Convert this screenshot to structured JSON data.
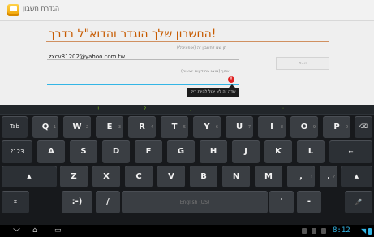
{
  "window": {
    "title": "הגדרת חשבון"
  },
  "form": {
    "heading": "החשבון שלך הוגדר והדוא\"ל בדרך!",
    "email_label": "תן שם לחשבון זה (אופציונלי)",
    "email_value": "zxcv81202@yahoo.com.tw",
    "name_label": "שמך (מוצג בהודעות יוצאות)",
    "next_label": "הבא",
    "error_tooltip": "שדה זה לא יכול להיות ריק",
    "error_mark": "!"
  },
  "keyboard": {
    "suggestions": [
      "!",
      "?",
      ",",
      ".",
      ":"
    ],
    "row1": [
      {
        "label": "Tab",
        "name": "key-tab"
      },
      {
        "label": "Q",
        "name": "key-q",
        "hint": "1"
      },
      {
        "label": "W",
        "name": "key-w",
        "hint": "2"
      },
      {
        "label": "E",
        "name": "key-e",
        "hint": "3"
      },
      {
        "label": "R",
        "name": "key-r",
        "hint": "4"
      },
      {
        "label": "T",
        "name": "key-t",
        "hint": "5"
      },
      {
        "label": "Y",
        "name": "key-y",
        "hint": "6"
      },
      {
        "label": "U",
        "name": "key-u",
        "hint": "7"
      },
      {
        "label": "I",
        "name": "key-i",
        "hint": "8"
      },
      {
        "label": "O",
        "name": "key-o",
        "hint": "9"
      },
      {
        "label": "P",
        "name": "key-p",
        "hint": "0"
      },
      {
        "label": "⌫",
        "name": "key-backspace"
      }
    ],
    "row2": [
      {
        "label": "?123",
        "name": "key-symbols"
      },
      {
        "label": "A",
        "name": "key-a"
      },
      {
        "label": "S",
        "name": "key-s"
      },
      {
        "label": "D",
        "name": "key-d"
      },
      {
        "label": "F",
        "name": "key-f"
      },
      {
        "label": "G",
        "name": "key-g"
      },
      {
        "label": "H",
        "name": "key-h"
      },
      {
        "label": "J",
        "name": "key-j"
      },
      {
        "label": "K",
        "name": "key-k"
      },
      {
        "label": "L",
        "name": "key-l"
      },
      {
        "label": "←",
        "name": "key-enter"
      }
    ],
    "row3": [
      {
        "label": "▲",
        "name": "key-shift-left"
      },
      {
        "label": "Z",
        "name": "key-z"
      },
      {
        "label": "X",
        "name": "key-x"
      },
      {
        "label": "C",
        "name": "key-c"
      },
      {
        "label": "V",
        "name": "key-v"
      },
      {
        "label": "B",
        "name": "key-b"
      },
      {
        "label": "N",
        "name": "key-n"
      },
      {
        "label": "M",
        "name": "key-m"
      },
      {
        "label": ",",
        "name": "key-comma",
        "hint": "!"
      },
      {
        "label": ".",
        "name": "key-period",
        "hint": "?"
      },
      {
        "label": "▲",
        "name": "key-shift-right"
      }
    ],
    "row4": [
      {
        "label": "⌗",
        "name": "key-settings"
      },
      {
        "label": ":-)",
        "name": "key-smiley"
      },
      {
        "label": "/",
        "name": "key-slash"
      },
      {
        "label": "English (US)",
        "name": "key-space"
      },
      {
        "label": "'",
        "name": "key-apostrophe"
      },
      {
        "label": "-",
        "name": "key-dash"
      },
      {
        "label": "🎤",
        "name": "key-mic"
      }
    ]
  },
  "statusbar": {
    "back": "﹀",
    "home": "⌂",
    "recent": "▭",
    "time": "8:12"
  }
}
